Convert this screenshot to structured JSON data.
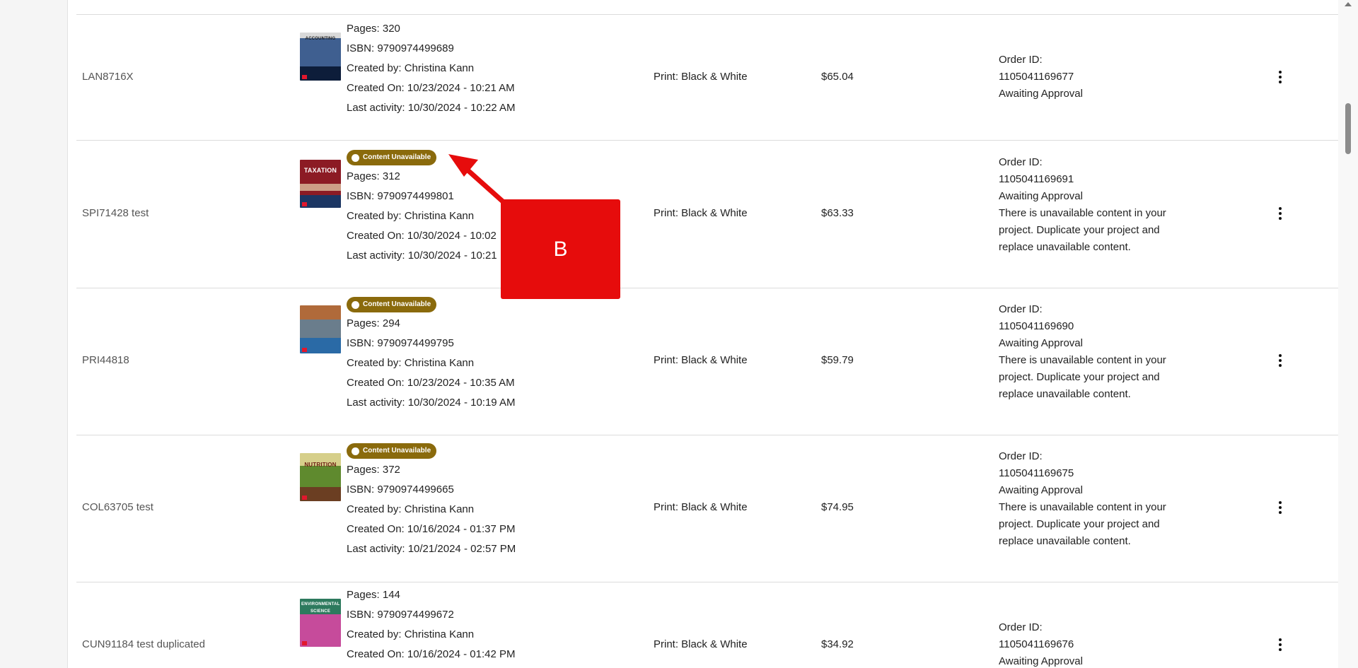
{
  "rows": [
    {
      "code": "LAN8716X",
      "badge": "",
      "pages": "Pages: 320",
      "isbn": "ISBN: 9790974499689",
      "created_by": "Created by: Christina Kann",
      "created_on": "Created On: 10/23/2024 - 10:21 AM",
      "last_activity": "Last activity: 10/30/2024 - 10:22 AM",
      "print": "Print: Black & White",
      "price": "$65.04",
      "order_label": "Order ID:",
      "order_id": "1105041169677",
      "status": "Awaiting Approval",
      "warning": "",
      "cover_title": "ACCOUNTING",
      "cover_colors": [
        "#0d1d3a",
        "#4a6fa5"
      ]
    },
    {
      "code": "SPI71428 test",
      "badge": "Content Unavailable",
      "pages": "Pages: 312",
      "isbn": "ISBN: 9790974499801",
      "created_by": "Created by: Christina Kann",
      "created_on": "Created On: 10/30/2024 - 10:02",
      "last_activity": "Last activity: 10/30/2024 - 10:21",
      "print": "Print: Black & White",
      "price": "$63.33",
      "order_label": "Order ID:",
      "order_id": "1105041169691",
      "status": "Awaiting Approval",
      "warning": "There is unavailable content in your project. Duplicate your project and replace unavailable content.",
      "cover_title": "TAXATION",
      "cover_colors": [
        "#8c1b24",
        "#1c3663"
      ]
    },
    {
      "code": "PRI44818",
      "badge": "Content Unavailable",
      "pages": "Pages: 294",
      "isbn": "ISBN: 9790974499795",
      "created_by": "Created by: Christina Kann",
      "created_on": "Created On: 10/23/2024 - 10:35 AM",
      "last_activity": "Last activity: 10/30/2024 - 10:19 AM",
      "print": "Print: Black & White",
      "price": "$59.79",
      "order_label": "Order ID:",
      "order_id": "1105041169690",
      "status": "Awaiting Approval",
      "warning": "There is unavailable content in your project. Duplicate your project and replace unavailable content.",
      "cover_title": "",
      "cover_colors": [
        "#a15a2c",
        "#2a6aa6"
      ]
    },
    {
      "code": "COL63705 test",
      "badge": "Content Unavailable",
      "pages": "Pages: 372",
      "isbn": "ISBN: 9790974499665",
      "created_by": "Created by: Christina Kann",
      "created_on": "Created On: 10/16/2024 - 01:37 PM",
      "last_activity": "Last activity: 10/21/2024 - 02:57 PM",
      "print": "Print: Black & White",
      "price": "$74.95",
      "order_label": "Order ID:",
      "order_id": "1105041169675",
      "status": "Awaiting Approval",
      "warning": "There is unavailable content in your project. Duplicate your project and replace unavailable content.",
      "cover_title": "NUTRITION",
      "cover_colors": [
        "#d6cf8a",
        "#4f7a2a"
      ]
    },
    {
      "code": "CUN91184 test duplicated",
      "badge": "",
      "pages": "Pages: 144",
      "isbn": "ISBN: 9790974499672",
      "created_by": "Created by: Christina Kann",
      "created_on": "Created On: 10/16/2024 - 01:42 PM",
      "last_activity": "",
      "print": "Print: Black & White",
      "price": "$34.92",
      "order_label": "Order ID:",
      "order_id": "1105041169676",
      "status": "Awaiting Approval",
      "warning": "",
      "cover_title": "ENVIRONMENTAL SCIENCE",
      "cover_colors": [
        "#2d7a5e",
        "#c64b9b"
      ]
    }
  ],
  "annotation": {
    "label": "B"
  },
  "icons": {
    "row_menu": "kebab-menu-icon",
    "badge": "dot-icon",
    "scroll_up": "scroll-up-arrow-icon"
  },
  "colors": {
    "badge_bg": "#8a6a0c",
    "annotation": "#e60c0c"
  }
}
